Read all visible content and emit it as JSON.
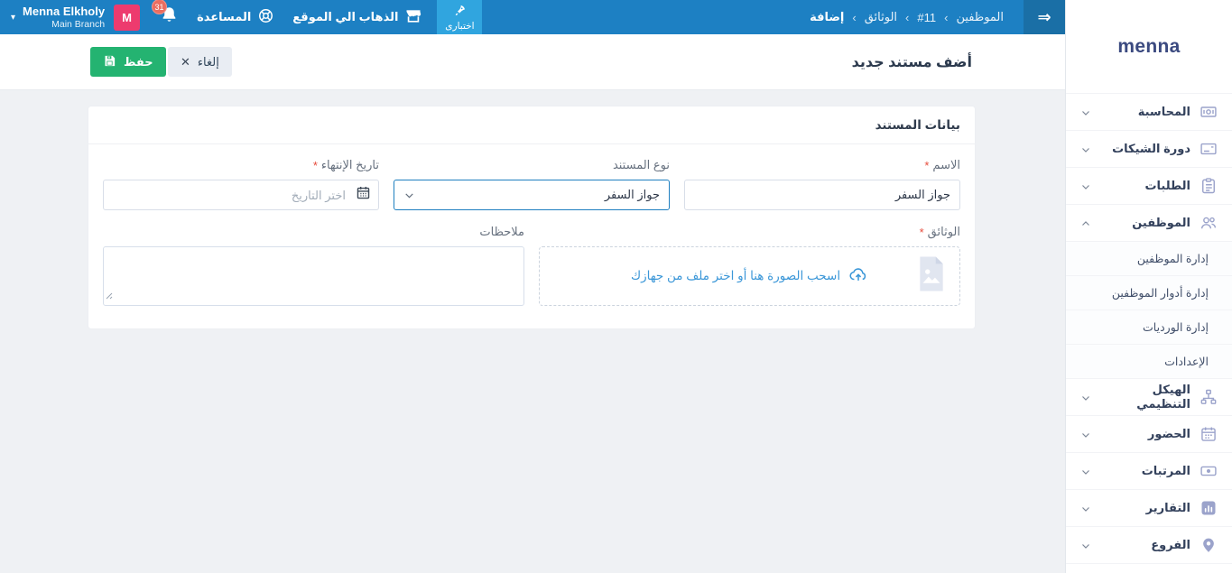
{
  "topbar": {
    "user_name": "Menna Elkholy",
    "user_branch": "Main Branch",
    "avatar_initial": "M",
    "notifications_count": "31",
    "help_label": "المساعدة",
    "go_to_site_label": "الذهاب الي الموقع",
    "trial_label": "اختبارى",
    "breadcrumb": {
      "items": [
        "الموظفين",
        "#11",
        "الوثائق",
        "إضافة"
      ],
      "separator": "‹"
    }
  },
  "sidebar": {
    "logo": "menna",
    "items": [
      {
        "label": "المحاسبة",
        "icon": "banknote-icon"
      },
      {
        "label": "دورة الشيكات",
        "icon": "cheque-icon"
      },
      {
        "label": "الطلبات",
        "icon": "clipboard-icon"
      },
      {
        "label": "الموظفين",
        "icon": "employees-icon",
        "expanded": true
      },
      {
        "label": "الهيكل التنظيمي",
        "icon": "org-chart-icon"
      },
      {
        "label": "الحضور",
        "icon": "calendar-icon"
      },
      {
        "label": "المرتبات",
        "icon": "money-icon"
      },
      {
        "label": "التقارير",
        "icon": "bar-chart-icon"
      },
      {
        "label": "الفروع",
        "icon": "map-pin-icon"
      }
    ],
    "employees_submenu": [
      "إدارة الموظفين",
      "إدارة أدوار الموظفين",
      "إدارة الورديات",
      "الإعدادات"
    ]
  },
  "page_header": {
    "title": "أضف مستند جديد",
    "save_label": "حفظ",
    "cancel_label": "إلغاء"
  },
  "form": {
    "card_title": "بيانات المستند",
    "required_marker": "*",
    "name": {
      "label": "الاسم",
      "value": "جواز السفر"
    },
    "document_type": {
      "label": "نوع المستند",
      "selected": "جواز السفر"
    },
    "expiry_date": {
      "label": "تاريخ الإنتهاء",
      "placeholder": "اختر التاريخ"
    },
    "documents": {
      "label": "الوثائق",
      "dropzone_text": "اسحب الصورة هنا أو اختر ملف من جهازك"
    },
    "notes": {
      "label": "ملاحظات",
      "value": ""
    }
  },
  "colors": {
    "topbar_blue": "#1d80c3",
    "toggle_blue": "#1a6fa6",
    "trial_blue": "#30a5df",
    "avatar_pink": "#ed3b6e",
    "badge_red": "#ea6d60",
    "save_green": "#24b371",
    "cancel_gray": "#e9edf3",
    "link_blue": "#3b97d8",
    "required_red": "#e74c3c",
    "focus_border_blue": "#1e7fc0",
    "sidebar_icon": "#9ba3cb"
  }
}
